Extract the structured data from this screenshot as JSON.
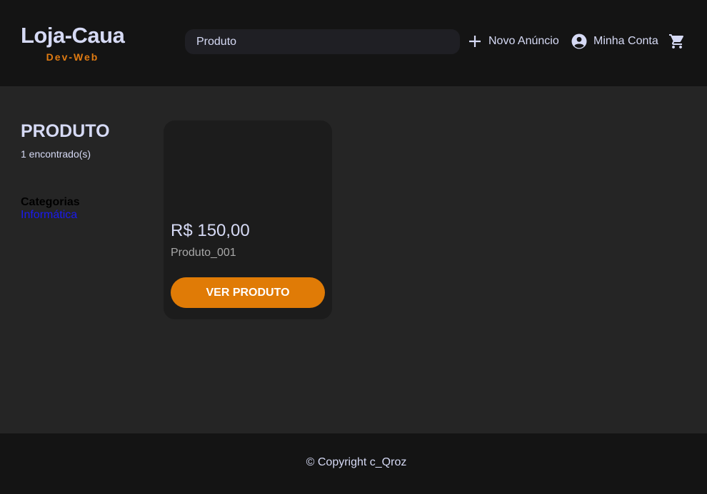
{
  "header": {
    "logo_title": "Loja-Caua",
    "logo_subtitle": "Dev-Web",
    "search_value": "Produto",
    "nav": {
      "new_ad_label": "Novo Anúncio",
      "account_label": "Minha Conta"
    }
  },
  "sidebar": {
    "title": "PRODUTO",
    "count_text": "1 encontrado(s)",
    "categories_heading": "Categorias",
    "categories": [
      "Informática"
    ]
  },
  "products": [
    {
      "price": "R$ 150,00",
      "name": "Produto_001",
      "button_label": "VER PRODUTO"
    }
  ],
  "footer": {
    "copyright": "© Copyright c_Qroz"
  },
  "colors": {
    "accent": "#e07b06",
    "header_bg": "#141414",
    "page_bg": "#252525",
    "card_bg": "#1c1c1c",
    "text": "#d6daf5",
    "link": "#1a1af0"
  },
  "icons": {
    "new_ad": "plus-icon",
    "account": "account-circle-icon",
    "cart": "shopping-cart-icon"
  }
}
